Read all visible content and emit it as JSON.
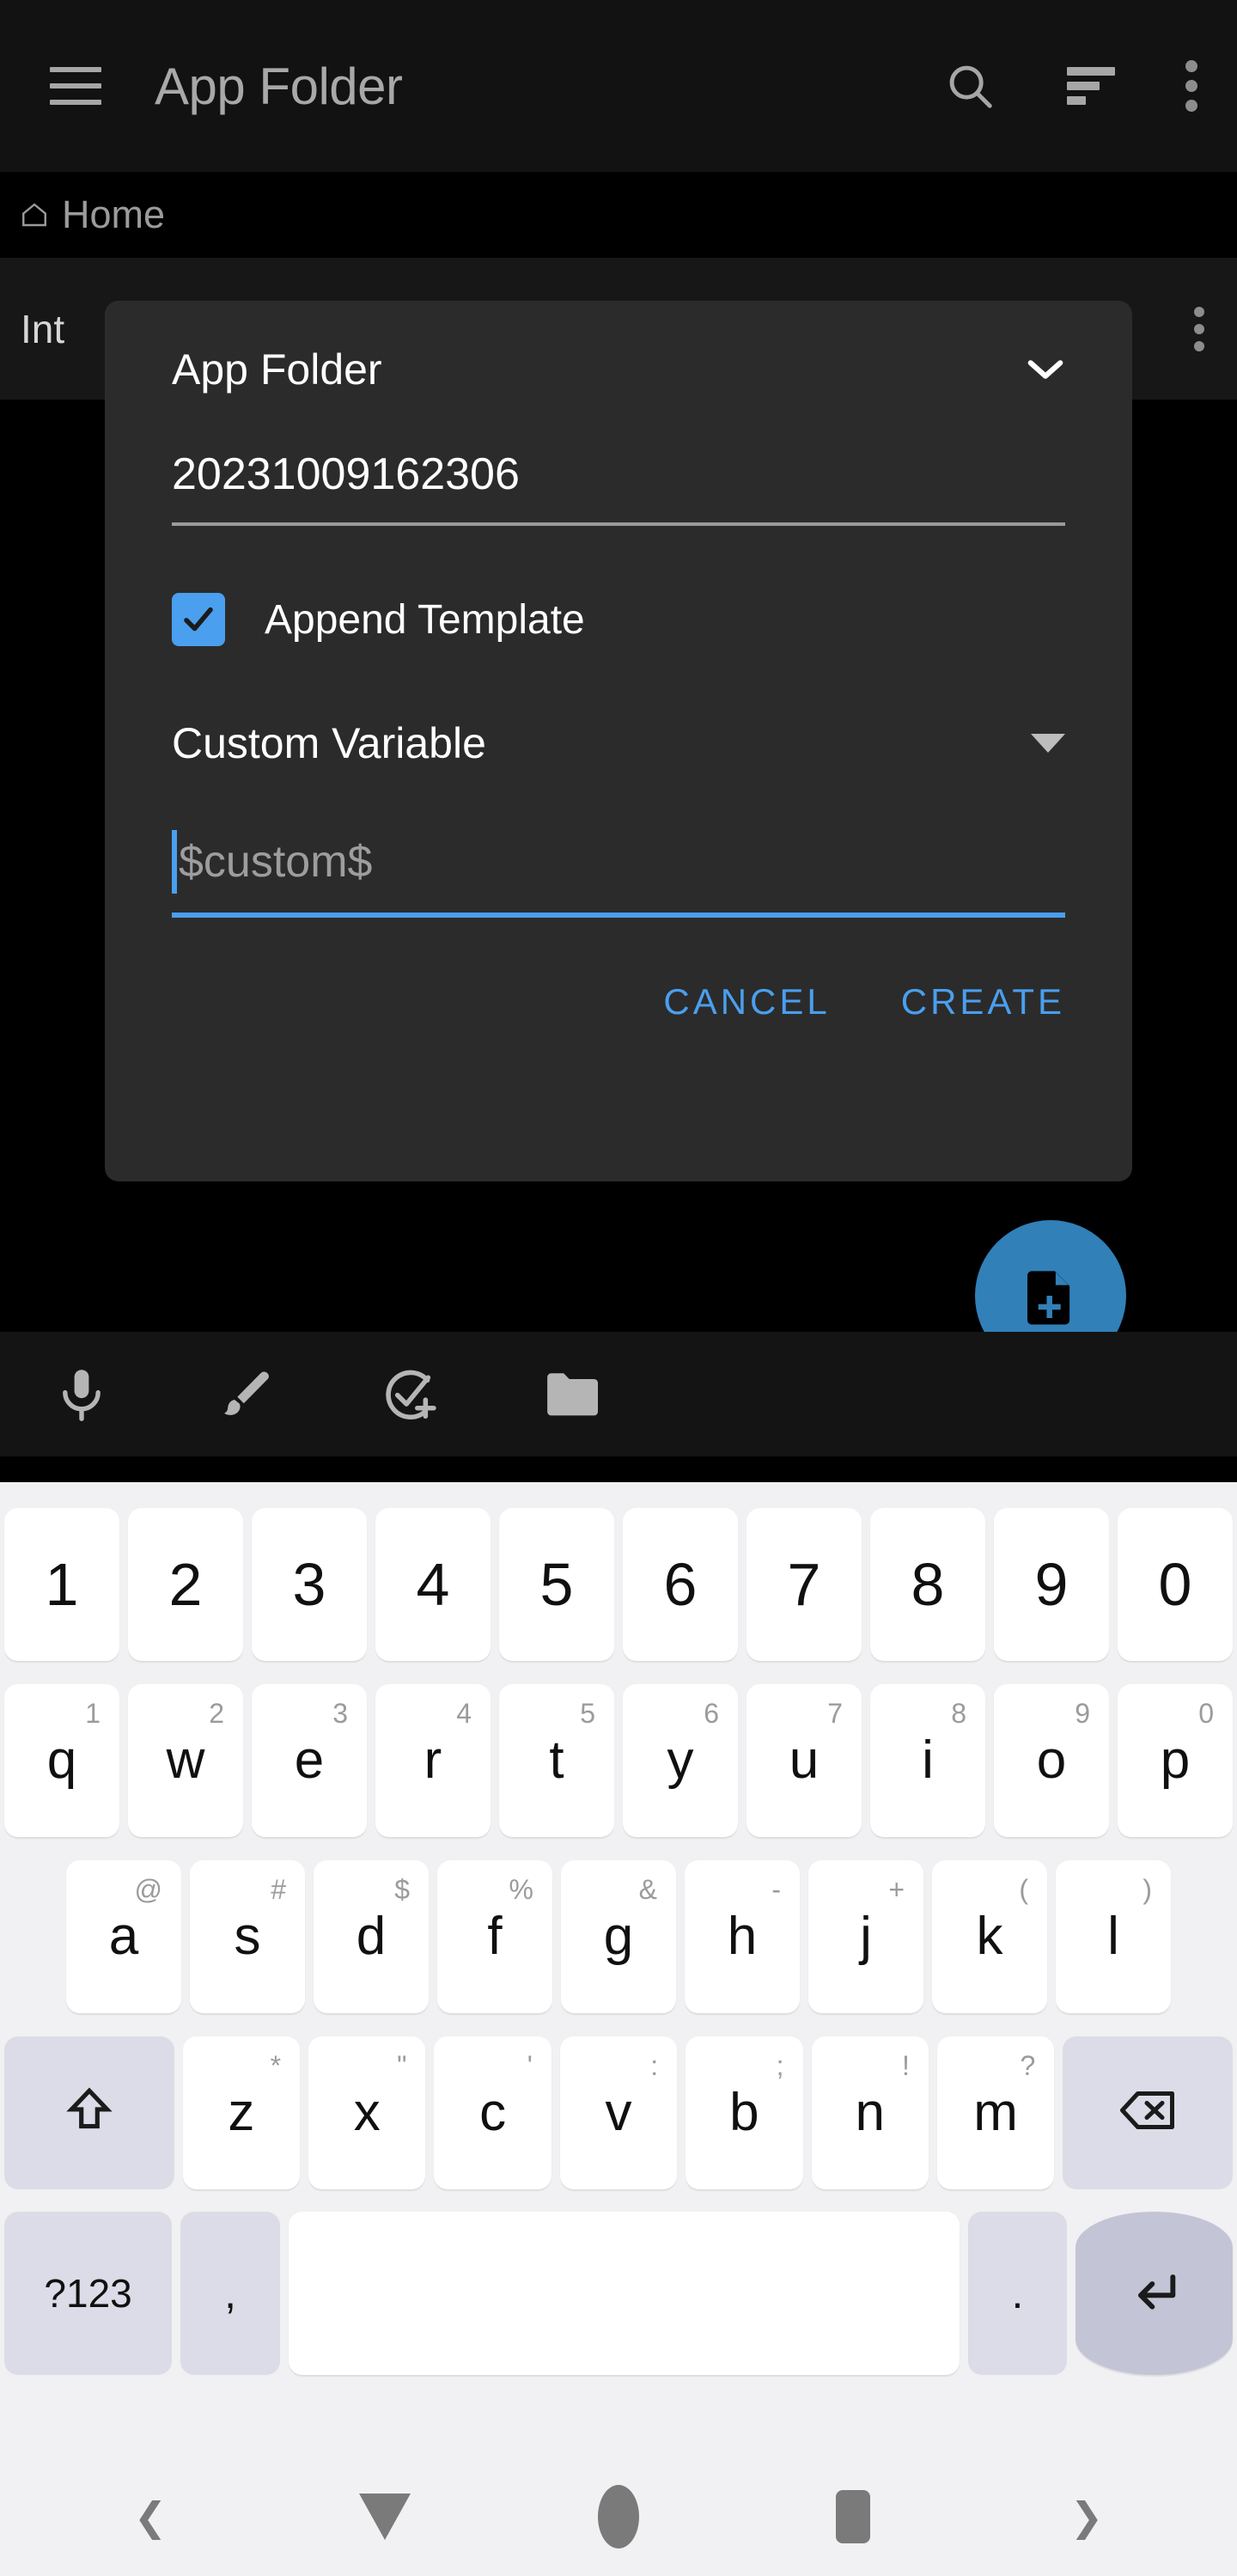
{
  "appbar": {
    "menu_icon": "hamburger-menu-icon",
    "title": "App Folder",
    "search_icon": "search-icon",
    "sort_icon": "sort-icon",
    "overflow_icon": "more-vertical-icon"
  },
  "breadcrumb": {
    "home_icon": "home-icon",
    "label": "Home"
  },
  "background_list": {
    "row_title": "Int",
    "row_overflow_icon": "more-vertical-icon"
  },
  "dialog": {
    "header_title": "App Folder",
    "header_chevron_icon": "chevron-down-icon",
    "filename_value": "20231009162306",
    "checkbox": {
      "checked": true,
      "icon": "checkmark-icon",
      "label": "Append Template"
    },
    "select": {
      "value": "Custom Variable",
      "caret_icon": "caret-down-icon"
    },
    "custom_input": {
      "placeholder": "$custom$",
      "value": "",
      "focused": true
    },
    "cancel_label": "CANCEL",
    "create_label": "CREATE"
  },
  "fab": {
    "icon": "new-document-icon",
    "color": "#3180b8"
  },
  "bottom_toolbar": {
    "items": [
      {
        "icon": "microphone-icon"
      },
      {
        "icon": "brush-icon"
      },
      {
        "icon": "add-task-icon"
      },
      {
        "icon": "folder-icon"
      }
    ]
  },
  "keyboard": {
    "row1": [
      {
        "main": "1"
      },
      {
        "main": "2"
      },
      {
        "main": "3"
      },
      {
        "main": "4"
      },
      {
        "main": "5"
      },
      {
        "main": "6"
      },
      {
        "main": "7"
      },
      {
        "main": "8"
      },
      {
        "main": "9"
      },
      {
        "main": "0"
      }
    ],
    "row2": [
      {
        "main": "q",
        "sup": "1"
      },
      {
        "main": "w",
        "sup": "2"
      },
      {
        "main": "e",
        "sup": "3"
      },
      {
        "main": "r",
        "sup": "4"
      },
      {
        "main": "t",
        "sup": "5"
      },
      {
        "main": "y",
        "sup": "6"
      },
      {
        "main": "u",
        "sup": "7"
      },
      {
        "main": "i",
        "sup": "8"
      },
      {
        "main": "o",
        "sup": "9"
      },
      {
        "main": "p",
        "sup": "0"
      }
    ],
    "row3": [
      {
        "main": "a",
        "sup": "@"
      },
      {
        "main": "s",
        "sup": "#"
      },
      {
        "main": "d",
        "sup": "$"
      },
      {
        "main": "f",
        "sup": "%"
      },
      {
        "main": "g",
        "sup": "&"
      },
      {
        "main": "h",
        "sup": "-"
      },
      {
        "main": "j",
        "sup": "+"
      },
      {
        "main": "k",
        "sup": "("
      },
      {
        "main": "l",
        "sup": ")"
      }
    ],
    "row4": {
      "shift_icon": "shift-icon",
      "keys": [
        {
          "main": "z",
          "sup": "*"
        },
        {
          "main": "x",
          "sup": "\""
        },
        {
          "main": "c",
          "sup": "'"
        },
        {
          "main": "v",
          "sup": ":"
        },
        {
          "main": "b",
          "sup": ";"
        },
        {
          "main": "n",
          "sup": "!"
        },
        {
          "main": "m",
          "sup": "?"
        }
      ],
      "backspace_icon": "backspace-icon"
    },
    "row5": {
      "symbols_label": "?123",
      "comma_label": ",",
      "space_label": "",
      "period_label": ".",
      "enter_icon": "enter-icon"
    }
  },
  "navbar": {
    "items": [
      {
        "icon": "chevron-left-icon"
      },
      {
        "icon": "back-triangle-icon"
      },
      {
        "icon": "home-circle-icon"
      },
      {
        "icon": "recents-square-icon"
      },
      {
        "icon": "chevron-right-icon"
      }
    ]
  }
}
